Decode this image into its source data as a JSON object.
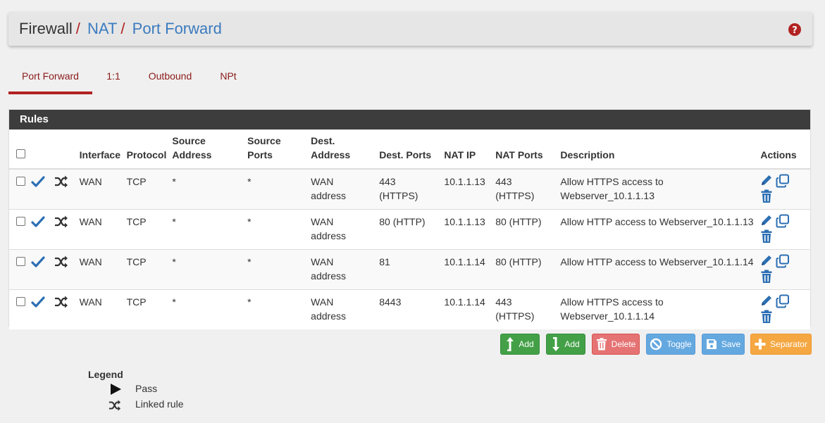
{
  "breadcrumb": {
    "items": [
      "Firewall",
      "NAT",
      "Port Forward"
    ],
    "separator": "/"
  },
  "tabs": [
    {
      "label": "Port Forward",
      "active": true
    },
    {
      "label": "1:1",
      "active": false
    },
    {
      "label": "Outbound",
      "active": false
    },
    {
      "label": "NPt",
      "active": false
    }
  ],
  "panel": {
    "title": "Rules",
    "columns": {
      "interface": "Interface",
      "protocol": "Protocol",
      "source_address_1": "Source",
      "source_address_2": "Address",
      "source_ports_1": "Source",
      "source_ports_2": "Ports",
      "dest_address_1": "Dest.",
      "dest_address_2": "Address",
      "dest_ports": "Dest. Ports",
      "nat_ip": "NAT IP",
      "nat_ports": "NAT Ports",
      "description": "Description",
      "actions": "Actions"
    },
    "rows": [
      {
        "interface": "WAN",
        "protocol": "TCP",
        "src_addr": "*",
        "src_ports": "*",
        "dst_addr_1": "WAN",
        "dst_addr_2": "address",
        "dst_ports_1": "443",
        "dst_ports_2": "(HTTPS)",
        "nat_ip": "10.1.1.13",
        "nat_ports_1": "443",
        "nat_ports_2": "(HTTPS)",
        "desc_1": "Allow HTTPS access to",
        "desc_2": "Webserver_10.1.1.13"
      },
      {
        "interface": "WAN",
        "protocol": "TCP",
        "src_addr": "*",
        "src_ports": "*",
        "dst_addr_1": "WAN",
        "dst_addr_2": "address",
        "dst_ports_1": "80 (HTTP)",
        "dst_ports_2": "",
        "nat_ip": "10.1.1.13",
        "nat_ports_1": "80 (HTTP)",
        "nat_ports_2": "",
        "desc_1": "Allow HTTP access to Webserver_10.1.1.13",
        "desc_2": ""
      },
      {
        "interface": "WAN",
        "protocol": "TCP",
        "src_addr": "*",
        "src_ports": "*",
        "dst_addr_1": "WAN",
        "dst_addr_2": "address",
        "dst_ports_1": "81",
        "dst_ports_2": "",
        "nat_ip": "10.1.1.14",
        "nat_ports_1": "80 (HTTP)",
        "nat_ports_2": "",
        "desc_1": "Allow HTTP access to Webserver_10.1.1.14",
        "desc_2": ""
      },
      {
        "interface": "WAN",
        "protocol": "TCP",
        "src_addr": "*",
        "src_ports": "*",
        "dst_addr_1": "WAN",
        "dst_addr_2": "address",
        "dst_ports_1": "8443",
        "dst_ports_2": "",
        "nat_ip": "10.1.1.14",
        "nat_ports_1": "443",
        "nat_ports_2": "(HTTPS)",
        "desc_1": "Allow HTTPS access to",
        "desc_2": "Webserver_10.1.1.14"
      }
    ]
  },
  "buttons": {
    "add_top": "Add",
    "add_bottom": "Add",
    "delete": "Delete",
    "toggle": "Toggle",
    "save": "Save",
    "separator": "Separator"
  },
  "legend": {
    "title": "Legend",
    "pass": "Pass",
    "linked": "Linked rule"
  },
  "icons": {
    "help": "question-circle-icon",
    "pass": "check-icon",
    "linked": "shuffle-icon",
    "edit": "pencil-icon",
    "copy": "copy-icon",
    "delete": "trash-icon"
  },
  "colors": {
    "accent_red": "#b22222",
    "link_blue": "#3b7bbf",
    "icon_blue": "#2c6fb3",
    "green": "#43a047",
    "red": "#e57373",
    "blue": "#64a8e0",
    "orange": "#f5a742"
  }
}
